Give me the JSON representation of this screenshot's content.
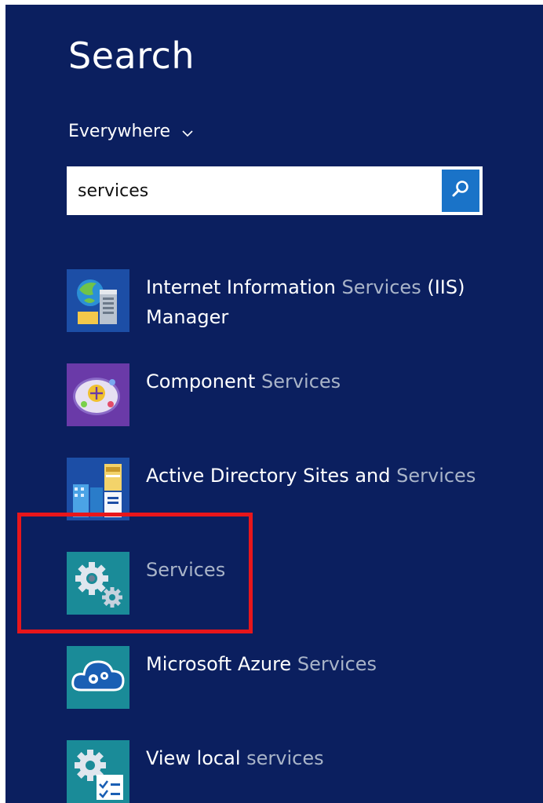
{
  "header": {
    "title": "Search"
  },
  "scope": {
    "label": "Everywhere"
  },
  "search": {
    "value": "services",
    "placeholder": ""
  },
  "results": [
    {
      "label_main": "Internet Information",
      "label_match": "Services",
      "label_tail": "(IIS) Manager",
      "icon": "iis-manager-icon",
      "tile_color": "#1c4ea6"
    },
    {
      "label_main": "Component",
      "label_match": "Services",
      "label_tail": "",
      "icon": "component-services-icon",
      "tile_color": "#6a3aa8"
    },
    {
      "label_main": "Active Directory Sites and",
      "label_match": "Services",
      "label_tail": "",
      "icon": "active-directory-sites-icon",
      "tile_color": "#1c4ea6"
    },
    {
      "label_main": "",
      "label_match": "Services",
      "label_tail": "",
      "icon": "services-gears-icon",
      "tile_color": "#1a8b98"
    },
    {
      "label_main": "Microsoft Azure",
      "label_match": "Services",
      "label_tail": "",
      "icon": "azure-cloud-icon",
      "tile_color": "#1a8b98"
    },
    {
      "label_main": "View local",
      "label_match": "services",
      "label_tail": "",
      "icon": "view-local-services-icon",
      "tile_color": "#1a8b98"
    }
  ],
  "colors": {
    "background": "#0b1f5f",
    "search_button": "#1a73c8",
    "highlight": "#e8161b",
    "dim_text": "#a9b4c8"
  }
}
